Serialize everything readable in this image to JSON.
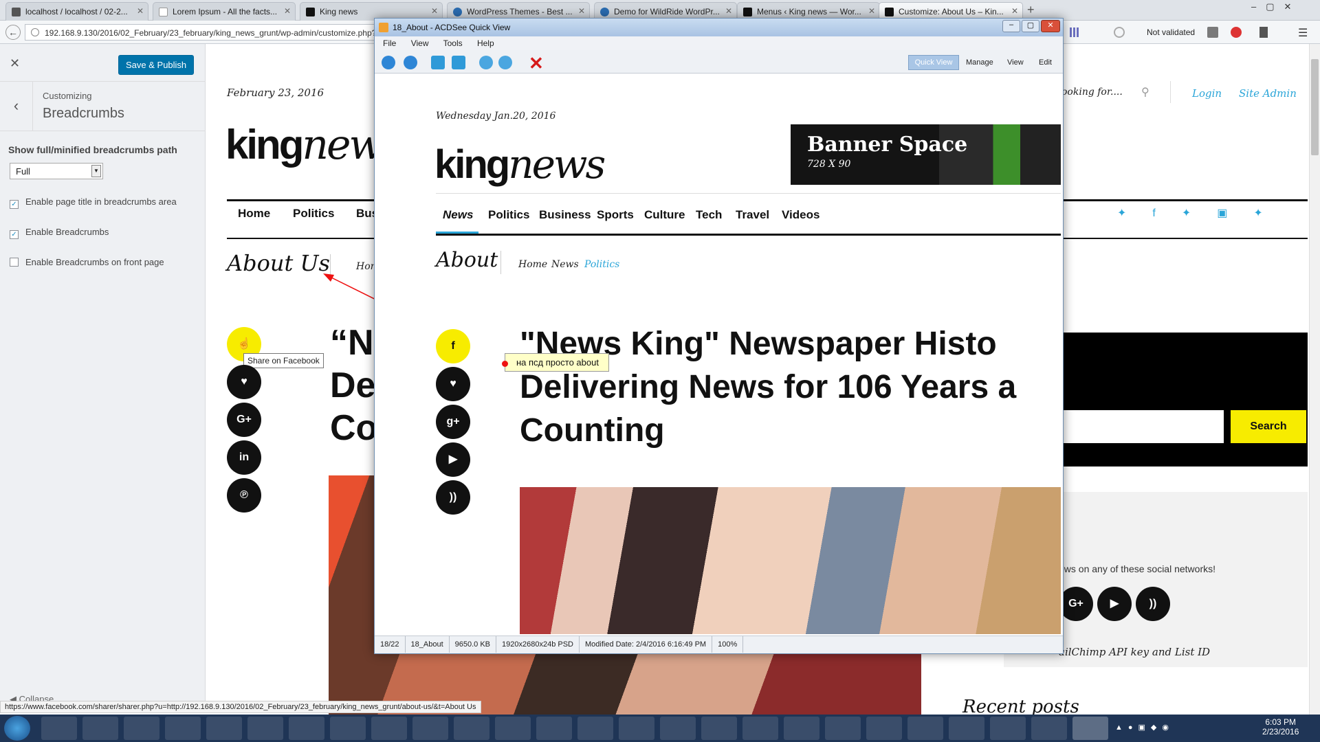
{
  "browser": {
    "tabs": [
      {
        "label": "localhost / localhost / 02-2..."
      },
      {
        "label": "Lorem Ipsum - All the facts..."
      },
      {
        "label": "King news"
      },
      {
        "label": "WordPress Themes - Best ..."
      },
      {
        "label": "Demo for WildRide WordPr..."
      },
      {
        "label": "Menus ‹ King news — Wor..."
      },
      {
        "label": "Customize: About Us – Kin..."
      }
    ],
    "url": "192.168.9.130/2016/02_February/23_february/king_news_grunt/wp-admin/customize.php?",
    "not_validated": "Not validated",
    "status_url": "https://www.facebook.com/sharer/sharer.php?u=http://192.168.9.130/2016/02_February/23_february/king_news_grunt/about-us/&t=About Us"
  },
  "customizer": {
    "save_label": "Save & Publish",
    "customizing": "Customizing",
    "section": "Breadcrumbs",
    "path_label": "Show full/minified breadcrumbs path",
    "path_value": "Full",
    "options": [
      {
        "label": "Enable page title in breadcrumbs area",
        "checked": true
      },
      {
        "label": "Enable Breadcrumbs",
        "checked": true
      },
      {
        "label": "Enable Breadcrumbs on front page",
        "checked": false
      }
    ],
    "collapse": "Collapse"
  },
  "site": {
    "date": "February 23, 2016",
    "logo_bold": "king",
    "logo_italic": "news",
    "nav": [
      "Home",
      "Politics",
      "Bus"
    ],
    "search_placeholder": "ooking for....",
    "login": "Login",
    "site_admin": "Site Admin",
    "page_title": "About Us",
    "breadcrumb_start": "Hon",
    "headline_lines": [
      "“N",
      "De",
      "Co"
    ],
    "tooltip": "Share on Facebook",
    "search_button": "Search",
    "widget_text": "ews on any of these social networks!",
    "mailchimp": "ailChimp API key and List ID",
    "recent_posts": "Recent posts",
    "widget_s": "s"
  },
  "acdsee": {
    "title": "18_About - ACDSee Quick View",
    "menu": [
      "File",
      "View",
      "Tools",
      "Help"
    ],
    "modes": [
      "Quick View",
      "Manage",
      "View",
      "Edit"
    ],
    "status": [
      "18/22",
      "18_About",
      "9650.0 KB",
      "1920x2680x24b PSD",
      "Modified Date: 2/4/2016 6:16:49 PM",
      "100%"
    ]
  },
  "psd": {
    "date": "Wednesday Jan.20, 2016",
    "logo_bold": "king",
    "logo_italic": "news",
    "banner_title": "Banner Space",
    "banner_size": "728 X 90",
    "nav": [
      "News",
      "Politics",
      "Business",
      "Sports",
      "Culture",
      "Tech",
      "Travel",
      "Videos"
    ],
    "page_title": "About",
    "crumbs": [
      "Home",
      "News",
      "Politics"
    ],
    "headline": [
      "\"News King\" Newspaper Histo",
      "Delivering News for 106 Years a",
      "Counting"
    ]
  },
  "annotation": {
    "text": "на псд просто about"
  },
  "taskbar": {
    "time": "6:03 PM",
    "date": "2/23/2016"
  }
}
